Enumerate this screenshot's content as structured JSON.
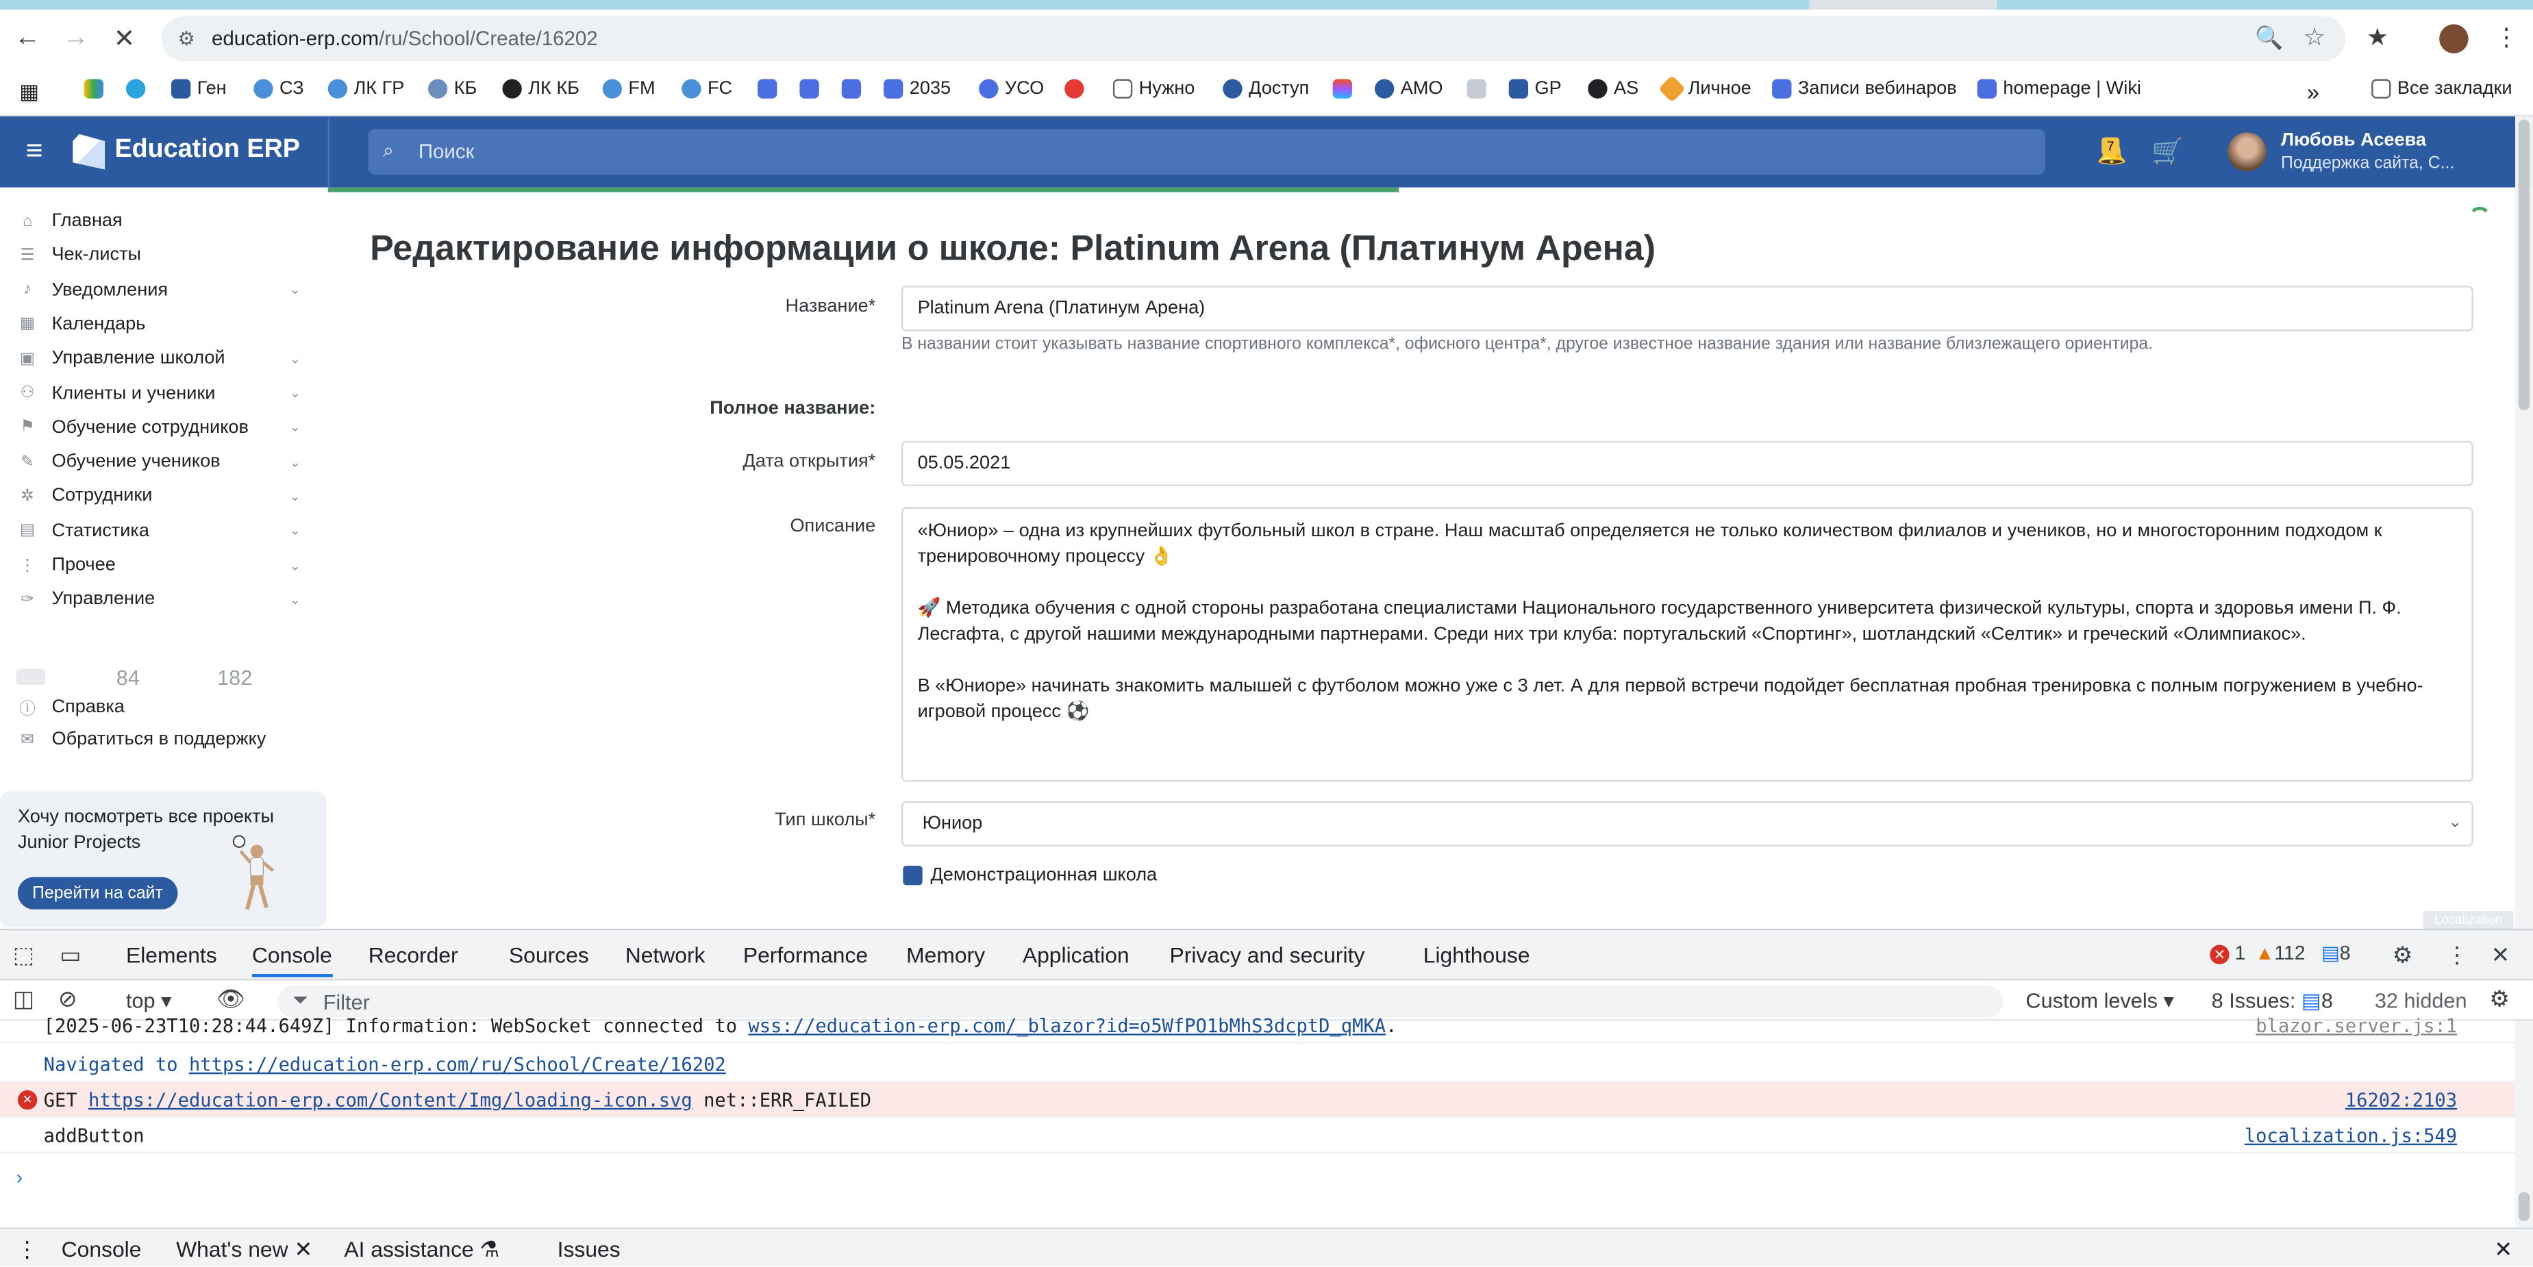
{
  "browser": {
    "url_domain": "education-erp.com",
    "url_path": "/ru/School/Create/16202",
    "bookmarks": [
      "Ген",
      "СЗ",
      "ЛК ГР",
      "КБ",
      "ЛК КБ",
      "FM",
      "FC",
      "2035",
      "УСО",
      "Нужно",
      "Доступ",
      "АМО",
      "GP",
      "AS",
      "Личное",
      "Записи вебинаров",
      "homepage | Wiki"
    ],
    "all_bookmarks": "Все закладки",
    "overflow": "»"
  },
  "header": {
    "brand": "Education ERP",
    "search_placeholder": "Поиск",
    "notifications_count": "7",
    "user_name": "Любовь Асеева",
    "user_role": "Поддержка сайта, С..."
  },
  "sidebar": {
    "items": [
      {
        "label": "Главная",
        "icon": "home-icon",
        "chevron": false
      },
      {
        "label": "Чек-листы",
        "icon": "list-icon",
        "chevron": false
      },
      {
        "label": "Уведомления",
        "icon": "bell-icon",
        "chevron": true
      },
      {
        "label": "Календарь",
        "icon": "calendar-icon",
        "chevron": false
      },
      {
        "label": "Управление школой",
        "icon": "building-icon",
        "chevron": true
      },
      {
        "label": "Клиенты и ученики",
        "icon": "users-icon",
        "chevron": true
      },
      {
        "label": "Обучение сотрудников",
        "icon": "graduation-icon",
        "chevron": true
      },
      {
        "label": "Обучение учеников",
        "icon": "book-icon",
        "chevron": true
      },
      {
        "label": "Сотрудники",
        "icon": "staff-icon",
        "chevron": true
      },
      {
        "label": "Статистика",
        "icon": "chart-icon",
        "chevron": true
      },
      {
        "label": "Прочее",
        "icon": "more-icon",
        "chevron": true
      },
      {
        "label": "Управление",
        "icon": "wrench-icon",
        "chevron": true
      }
    ],
    "stats_a": "84",
    "stats_b": "182",
    "help": "Справка",
    "support": "Обратиться в поддержку",
    "promo_text": "Хочу посмотреть все проекты Junior Projects",
    "promo_button": "Перейти на сайт"
  },
  "form": {
    "page_title": "Редактирование информации о школе: Platinum Arena (Платинум Арена)",
    "name_label": "Название*",
    "name_value": "Platinum Arena (Платинум Арена)",
    "name_hint": "В названии стоит указывать название спортивного комплекса*, офисного центра*, другое известное название здания или название близлежащего ориентира.",
    "fullname_label": "Полное название:",
    "open_date_label": "Дата открытия*",
    "open_date_value": "05.05.2021",
    "description_label": "Описание",
    "description_p1": "«Юниор» – одна из крупнейших футбольный школ в стране. Наш масштаб определяется не только количеством филиалов и учеников, но и многосторонним подходом к тренировочному процессу 👌",
    "description_p2": "🚀 Методика обучения с одной стороны разработана специалистами Национального государственного университета физической культуры, спорта и здоровья имени П. Ф. Лесгафта, с другой нашими международными партнерами. Среди них три клуба: португальский «Спортинг», шотландский «Селтик» и греческий «Олимпиакос».",
    "description_p3": "В «Юниоре» начинать знакомить малышей с футболом можно уже с 3 лет. А для первой встречи подойдет бесплатная пробная тренировка с полным погружением в учебно-игровой процесс ⚽",
    "school_type_label": "Тип школы*",
    "school_type_value": "Юниор",
    "demo_label": "Демонстрационная школа",
    "demo_checked": true,
    "localization_tag": "Localization"
  },
  "devtools": {
    "tabs": [
      "Elements",
      "Console",
      "Recorder",
      "Sources",
      "Network",
      "Performance",
      "Memory",
      "Application",
      "Privacy and security",
      "Lighthouse"
    ],
    "selected_tab": "Console",
    "errors": "1",
    "warnings": "112",
    "messages": "8",
    "context": "top",
    "filter_placeholder": "Filter",
    "levels": "Custom levels",
    "issues_label": "8 Issues:",
    "issues_count": "8",
    "hidden": "32 hidden",
    "log": [
      {
        "text": "[2025-06-23T10:28:44.649Z] Information: WebSocket connected to ",
        "link": "wss://education-erp.com/_blazor?id=o5WfPO1bMhS3dcptD_qMKA",
        "tail": ".",
        "src": "blazor.server.js:1",
        "type": "info"
      },
      {
        "text": "Navigated to ",
        "link": "https://education-erp.com/ru/School/Create/16202",
        "tail": "",
        "src": "",
        "type": "nav"
      },
      {
        "text": "GET ",
        "link": "https://education-erp.com/Content/Img/loading-icon.svg",
        "tail": " net::ERR_FAILED",
        "src": "16202:2103",
        "type": "error"
      },
      {
        "text": "addButton",
        "link": "",
        "tail": "",
        "src": "localization.js:549",
        "type": "log"
      }
    ],
    "drawer_tabs": [
      "Console",
      "What's new",
      "AI assistance",
      "Issues"
    ],
    "drawer_selected": "What's new"
  }
}
